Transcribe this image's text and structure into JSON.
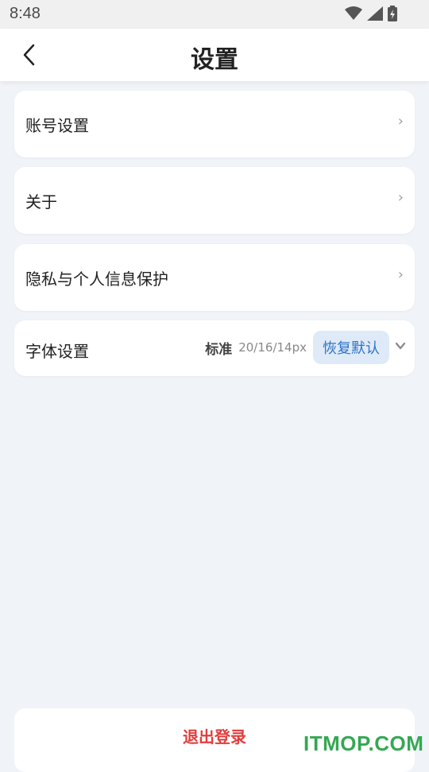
{
  "status_bar": {
    "time": "8:48",
    "icons": [
      "wifi-icon",
      "signal-icon",
      "battery-icon"
    ]
  },
  "header": {
    "title": "设置",
    "back_icon": "chevron-left-icon"
  },
  "settings": {
    "account": {
      "label": "账号设置",
      "icon": "chevron-right-icon",
      "arrow": "›"
    },
    "about": {
      "label": "关于",
      "icon": "chevron-right-icon",
      "arrow": "›"
    },
    "privacy": {
      "label": "隐私与个人信息保护",
      "icon": "chevron-right-icon",
      "arrow": "›"
    },
    "font": {
      "label": "字体设置",
      "level": "标准",
      "sizes": "20/16/14px",
      "restore_label": "恢复默认",
      "expand_icon": "chevron-down-icon"
    }
  },
  "logout": {
    "label": "退出登录"
  },
  "watermark": {
    "text": "ITMOP.COM",
    "color": "#34a853"
  },
  "colors": {
    "background": "#f0f3f7",
    "logout_text": "#e23c3c",
    "restore_bg": "#dfeaf8",
    "restore_text": "#2c73c6"
  }
}
